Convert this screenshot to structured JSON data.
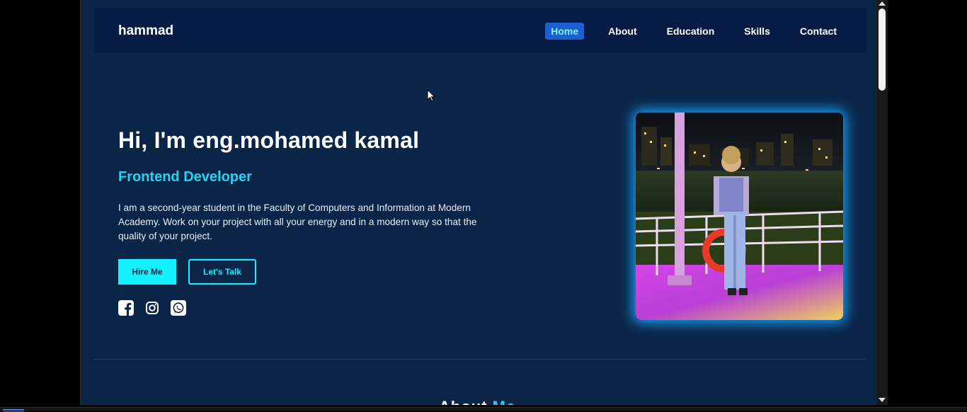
{
  "navbar": {
    "logo": "hammad",
    "links": [
      {
        "label": "Home",
        "active": true
      },
      {
        "label": "About",
        "active": false
      },
      {
        "label": "Education",
        "active": false
      },
      {
        "label": "Skills",
        "active": false
      },
      {
        "label": "Contact",
        "active": false
      }
    ]
  },
  "hero": {
    "title": "Hi, I'm eng.mohamed kamal",
    "role": "Frontend Developer",
    "description": "I am a second-year student in the Faculty of Computers and Information at Modern Academy. Work on your project with all your energy and in a modern way so that the quality of your project.",
    "hire_label": "Hire Me",
    "talk_label": "Let's Talk",
    "socials": [
      "facebook-icon",
      "instagram-icon",
      "whatsapp-icon"
    ]
  },
  "about_section": {
    "heading_start": "About",
    "heading_accent": "Me"
  },
  "colors": {
    "background": "#0b2548",
    "navbar": "#071c44",
    "accent": "#13f0ff",
    "role_text": "#21d4f3",
    "active_nav": "#1d5fd0",
    "photo_glow": "#19a6ff"
  }
}
